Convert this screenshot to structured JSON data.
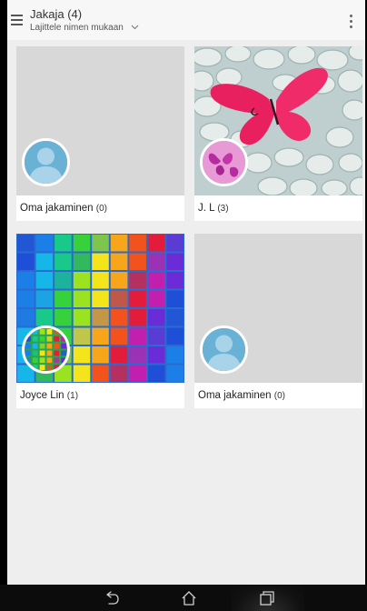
{
  "header": {
    "title": "Jakaja (4)",
    "sort_label": "Lajittele nimen mukaan",
    "menu_icon": "hamburger-menu-icon",
    "more_icon": "overflow-menu-icon",
    "dropdown_icon": "chevron-down-icon"
  },
  "cards": [
    {
      "name": "Oma jakaminen",
      "count": "(0)",
      "thumbnail": "empty-gray",
      "avatar": "default-person-icon"
    },
    {
      "name": "J. L",
      "count": "(3)",
      "thumbnail": "butterfly-on-pebbles",
      "avatar": "butterfly-photo"
    },
    {
      "name": "Joyce Lin",
      "count": "(1)",
      "thumbnail": "rainbow-cubes",
      "avatar": "rainbow-cubes-photo"
    },
    {
      "name": "Oma jakaminen",
      "count": "(0)",
      "thumbnail": "empty-gray",
      "avatar": "default-person-icon"
    }
  ],
  "navbar": {
    "back_icon": "back-icon",
    "home_icon": "home-icon",
    "recents_icon": "recent-apps-icon"
  },
  "colors": {
    "background": "#eeeeee",
    "appbar": "#f7f7f7",
    "avatar_blue": "#6ab1d6",
    "navbar": "#0c0c0c"
  }
}
